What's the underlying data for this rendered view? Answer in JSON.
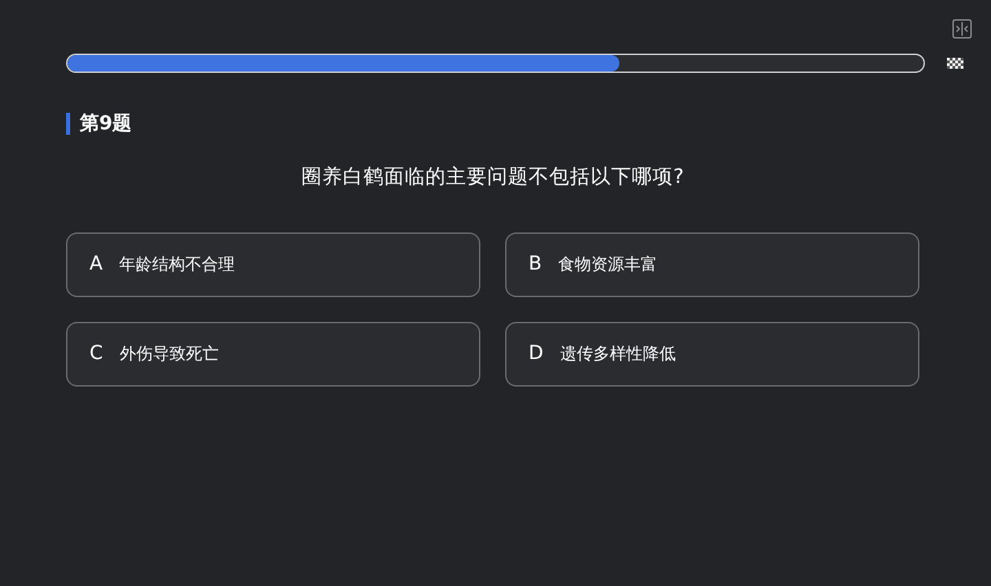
{
  "progress": {
    "level": 0.645
  },
  "question": {
    "number": "第9题",
    "text": "圈养白鹤面临的主要问题不包括以下哪项?"
  },
  "options": [
    {
      "letter": "A",
      "text": "年龄结构不合理",
      "selected": false
    },
    {
      "letter": "B",
      "text": "食物资源丰富",
      "selected": false
    },
    {
      "letter": "C",
      "text": "外伤导致死亡",
      "selected": false
    },
    {
      "letter": "D",
      "text": "遗传多样性降低",
      "selected": false
    }
  ]
}
